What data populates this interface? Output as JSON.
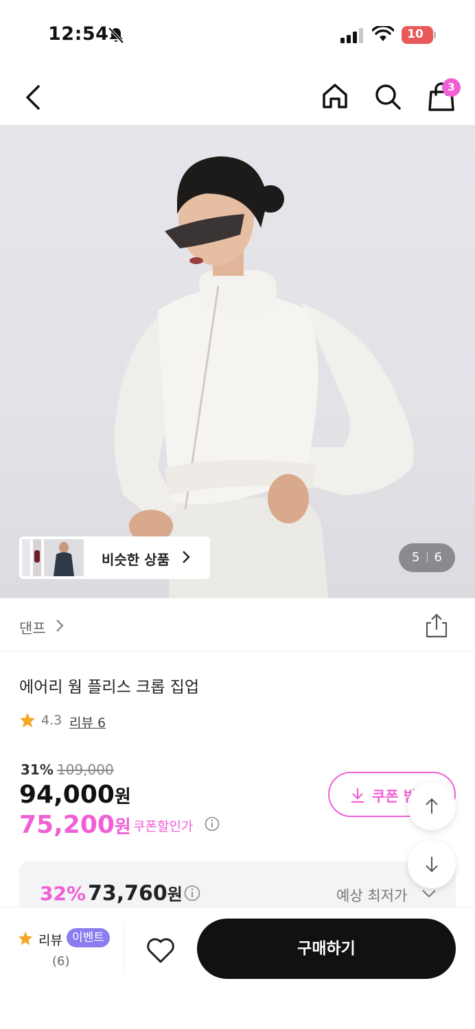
{
  "status_bar": {
    "time": "12:54",
    "battery": "10"
  },
  "nav": {
    "cart_count": "3"
  },
  "hero": {
    "similar_label": "비슷한 상품",
    "page_current": "5",
    "page_total": "6"
  },
  "brand": {
    "name": "댄프"
  },
  "product": {
    "title": "에어리 웜 플리스 크롭 집업",
    "rating": "4.3",
    "review_link": "리뷰 6",
    "discount_rate": "31%",
    "original_price": "109,000",
    "sale_price": "94,000",
    "sale_unit": "원",
    "coupon_price": "75,200",
    "coupon_unit": "원",
    "coupon_label": "쿠폰할인가",
    "coupon_button_label": "쿠폰 받"
  },
  "lowest": {
    "rate": "32%",
    "price": "73,760",
    "unit": "원",
    "label": "예상 최저가"
  },
  "bottom_bar": {
    "review_label": "리뷰",
    "event_badge": "이벤트",
    "review_count": "(6)",
    "buy_label": "구매하기"
  },
  "colors": {
    "accent_pink": "#f05fd6",
    "event_purple": "#8b7cf0",
    "buy_black": "#111111",
    "star_orange": "#f5a623"
  }
}
